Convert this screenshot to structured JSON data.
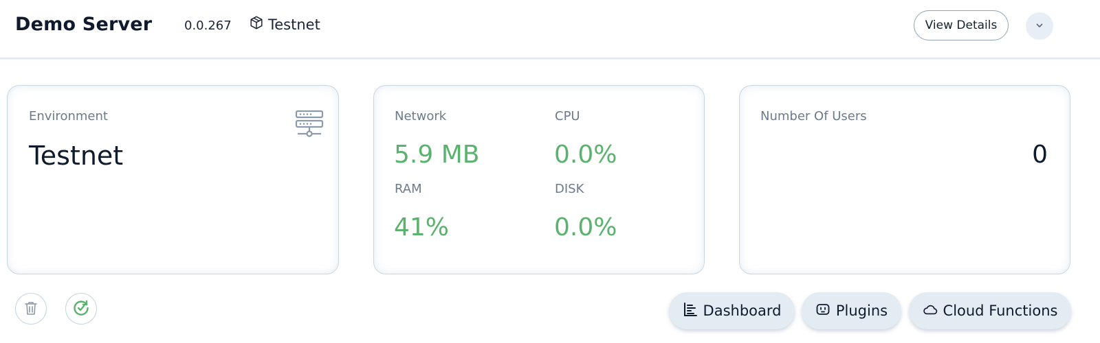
{
  "header": {
    "server_name": "Demo Server",
    "version": "0.0.267",
    "environment": "Testnet",
    "view_details_label": "View Details"
  },
  "cards": {
    "environment": {
      "label": "Environment",
      "value": "Testnet"
    },
    "stats": {
      "network_label": "Network",
      "network_value": "5.9 MB",
      "cpu_label": "CPU",
      "cpu_value": "0.0%",
      "ram_label": "RAM",
      "ram_value": "41%",
      "disk_label": "DISK",
      "disk_value": "0.0%"
    },
    "users": {
      "label": "Number Of Users",
      "value": "0"
    }
  },
  "actions": {
    "dashboard_label": "Dashboard",
    "plugins_label": "Plugins",
    "cloud_functions_label": "Cloud Functions"
  },
  "colors": {
    "accent_green": "#5bb26e",
    "text_dark": "#0f1b2d",
    "muted": "#6c7a89",
    "pill_bg": "#e3ebf3"
  },
  "icons": {
    "environment_tag": "cube-icon",
    "environment_card": "server-icon",
    "expand": "chevron-down-icon",
    "delete": "trash-icon",
    "restart": "refresh-check-icon",
    "dashboard": "dashboard-bars-icon",
    "plugins": "plug-icon",
    "cloud_functions": "cloud-icon"
  }
}
